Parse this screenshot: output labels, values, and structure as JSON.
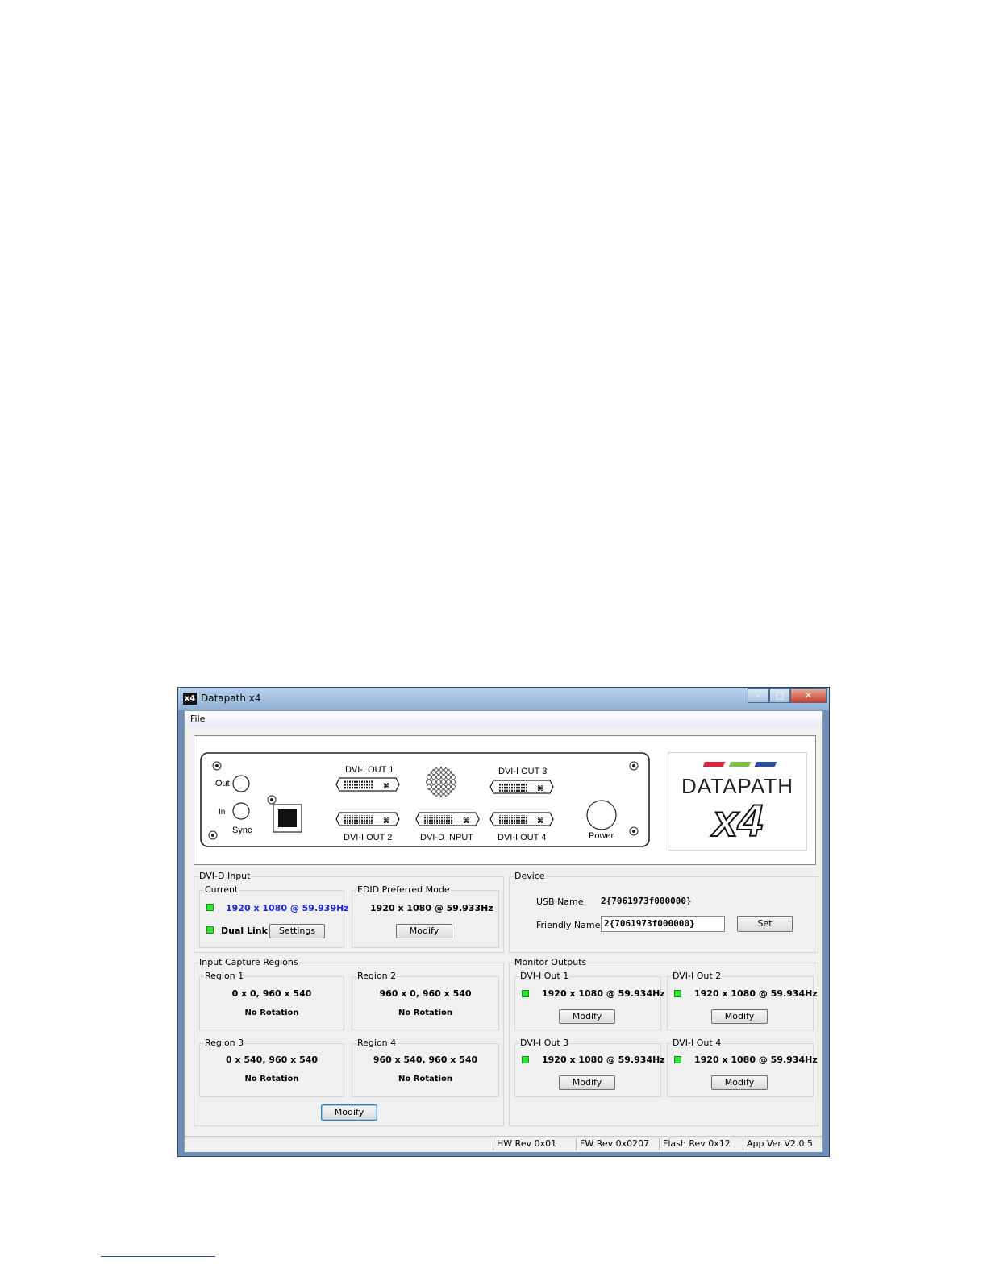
{
  "window": {
    "title": "Datapath x4",
    "app_icon": "x4"
  },
  "menu": {
    "file": "File"
  },
  "device_panel": {
    "dvi_out_1": "DVI-I OUT 1",
    "dvi_out_2": "DVI-I OUT 2",
    "dvi_out_3": "DVI-I OUT 3",
    "dvi_out_4": "DVI-I OUT 4",
    "dvi_input": "DVI-D INPUT",
    "sync_out": "Out",
    "sync_in": "In",
    "sync": "Sync",
    "power": "Power",
    "logo_brand": "DATAPATH",
    "logo_model": "x4",
    "logo_colors": [
      "#e0243a",
      "#7cc242",
      "#2a4fa8"
    ]
  },
  "dvi_input": {
    "label": "DVI-D Input",
    "current_label": "Current",
    "current_mode": "1920 x 1080 @ 59.939Hz",
    "dual_link": "Dual Link",
    "settings_btn": "Settings",
    "edid_label": "EDID Preferred Mode",
    "edid_mode": "1920 x 1080 @ 59.933Hz",
    "modify_btn": "Modify"
  },
  "device": {
    "label": "Device",
    "usb_name_label": "USB Name",
    "usb_name": "2{7061973f000000}",
    "friendly_name_label": "Friendly Name",
    "friendly_name": "2{7061973f000000}",
    "set_btn": "Set"
  },
  "capture": {
    "label": "Input Capture Regions",
    "regions": [
      {
        "name": "Region 1",
        "geometry": "0 x 0, 960 x 540",
        "rotation": "No Rotation"
      },
      {
        "name": "Region 2",
        "geometry": "960 x 0, 960 x 540",
        "rotation": "No Rotation"
      },
      {
        "name": "Region 3",
        "geometry": "0 x 540, 960 x 540",
        "rotation": "No Rotation"
      },
      {
        "name": "Region 4",
        "geometry": "960 x 540, 960 x 540",
        "rotation": "No Rotation"
      }
    ],
    "modify_btn": "Modify"
  },
  "outputs": {
    "label": "Monitor Outputs",
    "items": [
      {
        "name": "DVI-I Out 1",
        "mode": "1920 x 1080 @ 59.934Hz",
        "btn": "Modify"
      },
      {
        "name": "DVI-I Out 2",
        "mode": "1920 x 1080 @ 59.934Hz",
        "btn": "Modify"
      },
      {
        "name": "DVI-I Out 3",
        "mode": "1920 x 1080 @ 59.934Hz",
        "btn": "Modify"
      },
      {
        "name": "DVI-I Out 4",
        "mode": "1920 x 1080 @ 59.934Hz",
        "btn": "Modify"
      }
    ]
  },
  "status": {
    "hw": "HW Rev 0x01",
    "fw": "FW Rev 0x0207",
    "flash": "Flash Rev 0x12",
    "app": "App Ver V2.0.5"
  }
}
